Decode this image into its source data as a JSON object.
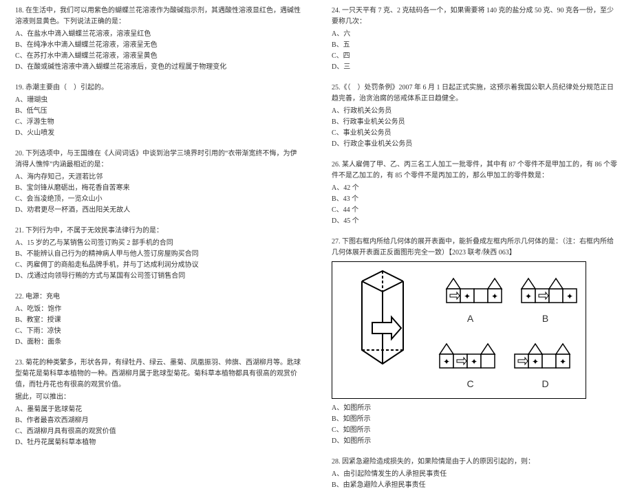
{
  "left": {
    "q18": {
      "stem": "18. 在生活中，我们可以用紫色的蝴蝶兰花溶液作为酸碱指示剂，其遇酸性溶液显红色，遇碱性溶液则显黄色。下列说法正确的是：",
      "a": "A、在盐水中滴入蝴蝶兰花溶液，溶液呈红色",
      "b": "B、在纯净水中滴入蝴蝶兰花溶液，溶液呈无色",
      "c": "C、在苏打水中滴入蝴蝶兰花溶液，溶液呈黄色",
      "d": "D、在酸或碱性溶液中滴入蝴蝶兰花溶液后，变色的过程属于物理变化"
    },
    "q19": {
      "stem": "19. 赤潮主要由（　）引起的。",
      "a": "A、珊瑚虫",
      "b": "B、低气压",
      "c": "C、浮游生物",
      "d": "D、火山喷发"
    },
    "q20": {
      "stem": "20. 下列选项中，与王国维在《人间词话》中谈到治学三境界时引用的“衣带渐宽终不悔，为伊消得人憔悴”内涵最相近的是：",
      "a": "A、海内存知己，天涯若比邻",
      "b": "B、宝剑锋从磨砺出，梅花香自苦寒来",
      "c": "C、会当凌绝顶，一览众山小",
      "d": "D、劝君更尽一杯酒，西出阳关无故人"
    },
    "q21": {
      "stem": "21. 下列行为中，不属于无效民事法律行为的是：",
      "a": "A、15 岁的乙与某销售公司签订购买 2 部手机的合同",
      "b": "B、不能辨认自己行为的精神病人甲与他人签订房屋购买合同",
      "c": "C、丙雇佣丁的商船走私品牌手机，并与丁达成利润分成协议",
      "d": "D、戊通过向领导行贿的方式与某国有公司签订销售合同"
    },
    "q22": {
      "stem": "22. 电源：充电",
      "a": "A、吃饭：饱作",
      "b": "B、教室：授课",
      "c": "C、下雨：凉快",
      "d": "D、面粉：面条"
    },
    "q23": {
      "stem1": "23. 菊花的种类繁多，形状各异，有绿牡丹、绿云、墨菊、凤凰振羽、帅旗、西湖柳月等。匙球型菊花是菊科草本植物的一种。西湖柳月属于匙球型菊花。菊科草本植物都具有很高的观赏价值，而牡丹花也有很高的观赏价值。",
      "stem2": "据此，可以推出：",
      "a": "A、墨菊属于匙球菊花",
      "b": "B、作者最喜欢西湖柳月",
      "c": "C、西湖柳月具有很高的观赏价值",
      "d": "D、牡丹花属菊科草本植物"
    }
  },
  "right": {
    "q24": {
      "stem": "24. 一只天平有 7 克、2 克砝码各一个，如果需要将 140 克的盐分成 50 克、90 克各一份，至少要称几次：",
      "a": "A、六",
      "b": "B、五",
      "c": "C、四",
      "d": "D、三"
    },
    "q25": {
      "stem": "25.《（　）处罚条例》2007 年 6 月 1 日起正式实施，这预示着我国公职人员纪律处分规范正日趋完善，治贪治腐的惩戒体系正日趋健全。",
      "a": "A、行政机关公务员",
      "b": "B、行政事业机关公务员",
      "c": "C、事业机关公务员",
      "d": "D、行政企事业机关公务员"
    },
    "q26": {
      "stem": "26. 某人雇佣了甲、乙、丙三名工人加工一批零件，其中有 87 个零件不是甲加工的，有 86 个零件不是乙加工的，有 85 个零件不是丙加工的，那么甲加工的零件数是：",
      "a": "A、42 个",
      "b": "B、43 个",
      "c": "C、44 个",
      "d": "D、45 个"
    },
    "q27": {
      "stem": "27. 下图右框内所给几何体的展开表面中，能折叠成左框内所示几何体的是：（注：右框内所给几何体展开表面正反面图形完全一致）【2023 联考/陕西 063】",
      "labelA": "A",
      "labelB": "B",
      "labelC": "C",
      "labelD": "D",
      "a": "A、如图所示",
      "b": "B、如图所示",
      "c": "C、如图所示",
      "d": "D、如图所示"
    },
    "q28": {
      "stem": "28. 因紧急避险造成损失的，如果险情是由于人的原因引起的，则：",
      "a": "A、由引起险情发生的人承担民事责任",
      "b": "B、由紧急避险人承担民事责任"
    }
  }
}
